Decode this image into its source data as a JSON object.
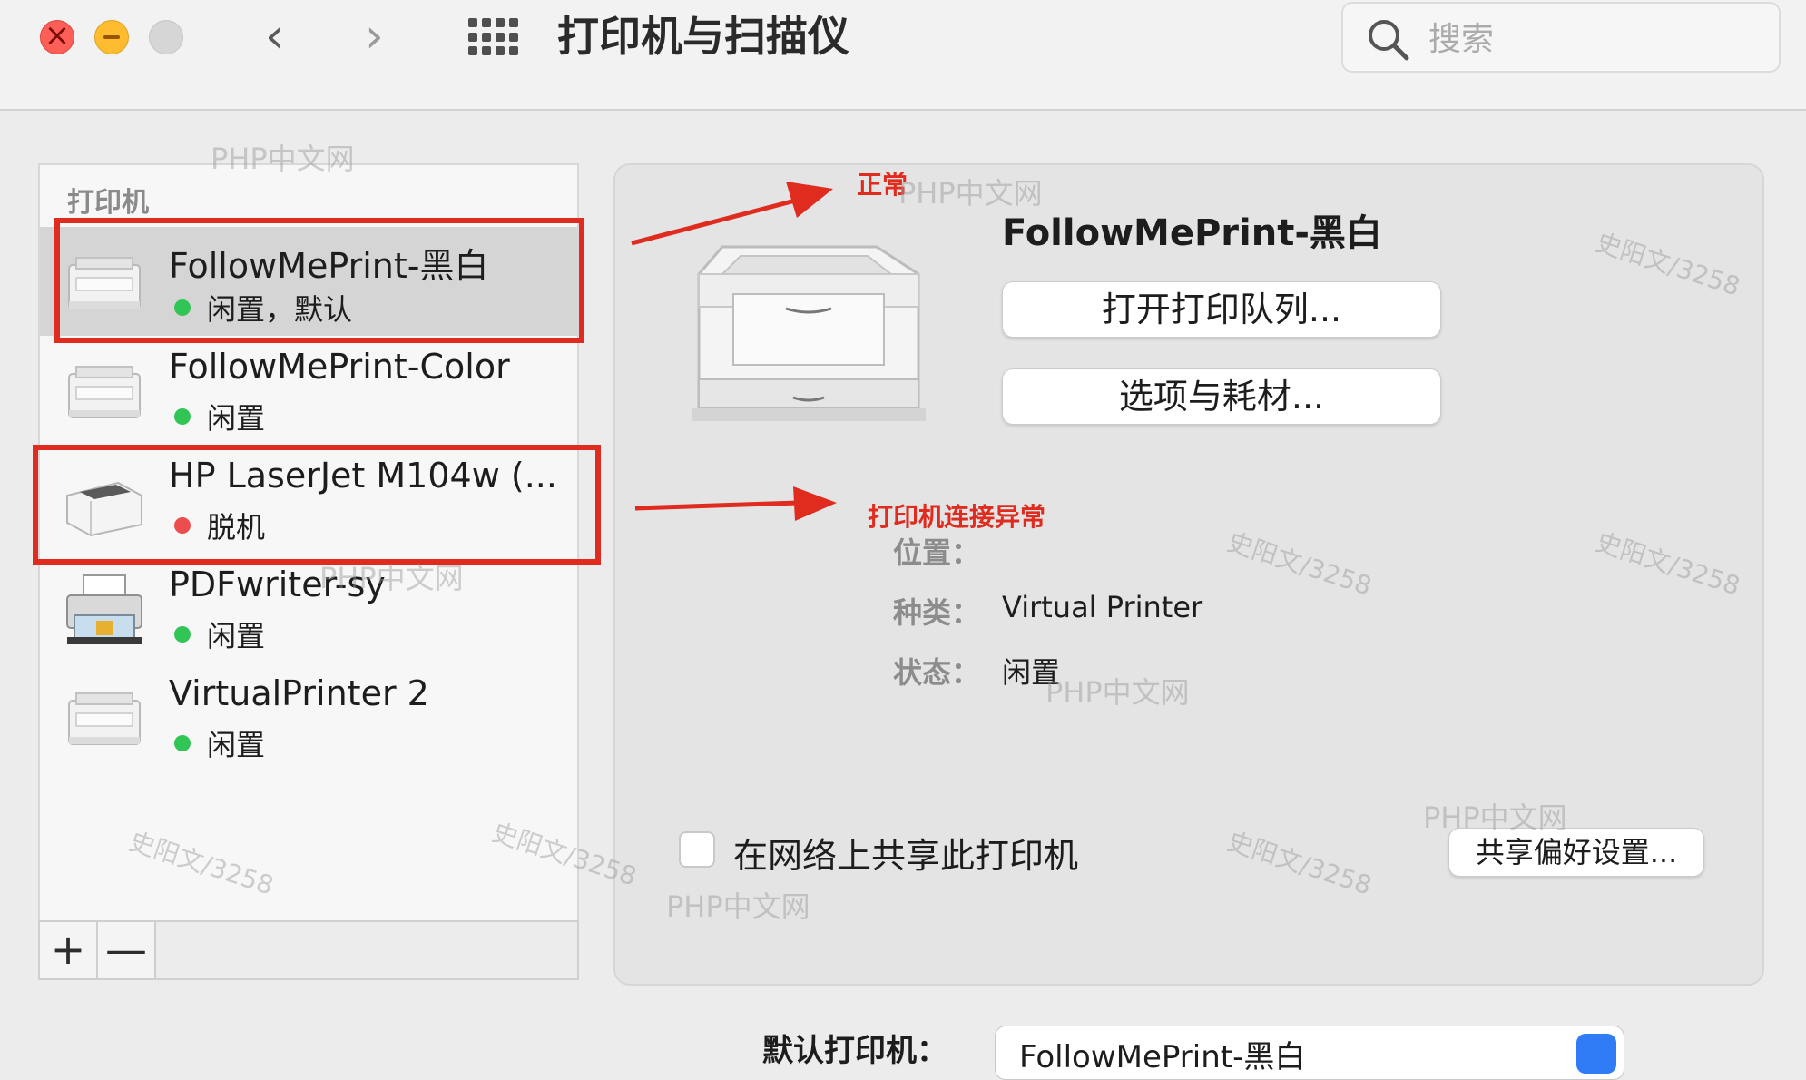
{
  "window": {
    "title": "打印机与扫描仪",
    "nav_back": "‹",
    "nav_forward": "›"
  },
  "search": {
    "placeholder": "搜索"
  },
  "printers_panel": {
    "header": "打印机",
    "items": [
      {
        "name": "FollowMePrint-黑白",
        "status": "闲置，默认",
        "status_color": "#31c555",
        "selected": true
      },
      {
        "name": "FollowMePrint-Color",
        "status": "闲置",
        "status_color": "#31c555"
      },
      {
        "name": "HP LaserJet M104w (...",
        "status": "脱机",
        "status_color": "#ec4e4e"
      },
      {
        "name": "PDFwriter-sy",
        "status": "闲置",
        "status_color": "#31c555"
      },
      {
        "name": "VirtualPrinter 2",
        "status": "闲置",
        "status_color": "#31c555"
      }
    ],
    "add_label": "+",
    "remove_label": "—"
  },
  "detail": {
    "printer_name": "FollowMePrint-黑白",
    "open_queue_label": "打开打印队列...",
    "options_label": "选项与耗材...",
    "location_label": "位置：",
    "location_value": "",
    "kind_label": "种类：",
    "kind_value": "Virtual Printer",
    "status_label": "状态：",
    "status_value": "闲置",
    "share_label": "在网络上共享此打印机",
    "share_prefs_label": "共享偏好设置..."
  },
  "footer": {
    "default_printer_label": "默认打印机：",
    "default_printer_value": "FollowMePrint-黑白"
  },
  "annotations": {
    "normal": "正常",
    "connection_error": "打印机连接异常",
    "color": "#e02b1f"
  },
  "watermarks": {
    "php": "PHP中文网",
    "sig": "史阳文/3258"
  }
}
